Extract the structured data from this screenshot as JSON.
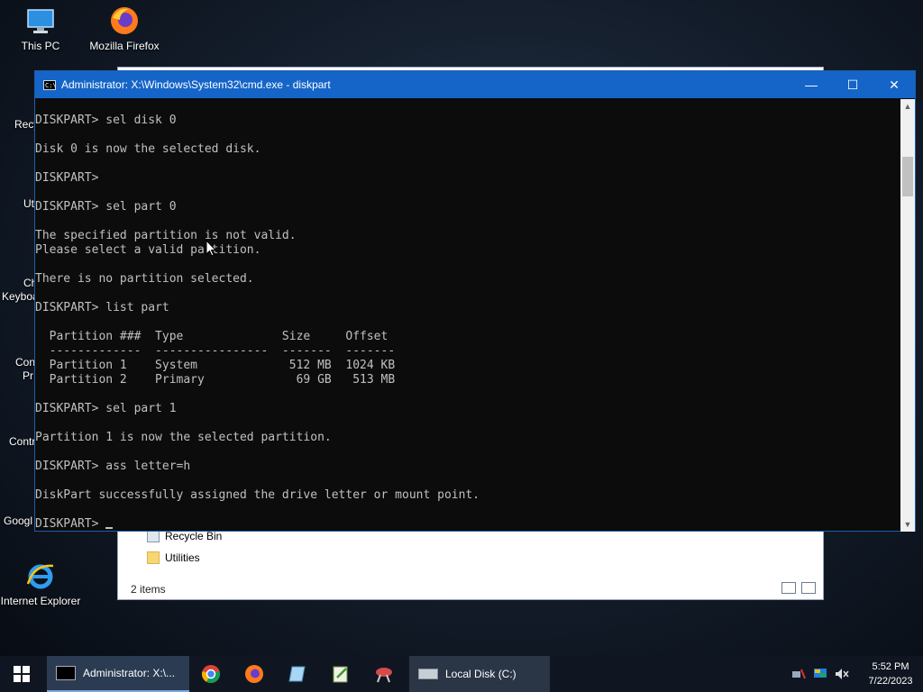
{
  "desktop": {
    "icons": [
      {
        "label": "This PC",
        "icon": "this-pc-icon"
      },
      {
        "label": "Mozilla Firefox",
        "icon": "firefox-icon"
      },
      {
        "label": "Internet Explorer",
        "icon": "internet-explorer-icon"
      }
    ],
    "partial_labels": [
      "Recy",
      "Ut",
      "Ch",
      "Keyboa",
      "Con",
      "Pr",
      "Contr",
      "Googl"
    ]
  },
  "explorer": {
    "items": [
      {
        "label": "Recycle Bin",
        "icon": "recycle-bin-icon"
      },
      {
        "label": "Utilities",
        "icon": "folder-icon"
      }
    ],
    "status": "2 items"
  },
  "cmd": {
    "title": "Administrator: X:\\Windows\\System32\\cmd.exe - diskpart",
    "lines": [
      "DISKPART> sel disk 0",
      "",
      "Disk 0 is now the selected disk.",
      "",
      "DISKPART>",
      "",
      "DISKPART> sel part 0",
      "",
      "The specified partition is not valid.",
      "Please select a valid partition.",
      "",
      "There is no partition selected.",
      "",
      "DISKPART> list part",
      "",
      "  Partition ###  Type              Size     Offset",
      "  -------------  ----------------  -------  -------",
      "  Partition 1    System             512 MB  1024 KB",
      "  Partition 2    Primary             69 GB   513 MB",
      "",
      "DISKPART> sel part 1",
      "",
      "Partition 1 is now the selected partition.",
      "",
      "DISKPART> ass letter=h",
      "",
      "DiskPart successfully assigned the drive letter or mount point.",
      ""
    ],
    "prompt": "DISKPART> "
  },
  "taskbar": {
    "items": [
      {
        "label": "Administrator: X:\\...",
        "icon": "cmd-icon",
        "active": true
      },
      {
        "label": "Local Disk (C:)",
        "icon": "drive-icon",
        "active": false
      }
    ],
    "pinned": [
      "chrome-icon",
      "firefox-icon",
      "notepad-icon",
      "edit-icon",
      "tool-icon"
    ],
    "clock": {
      "time": "5:52 PM",
      "date": "7/22/2023"
    }
  },
  "colors": {
    "titlebar": "#1565c8",
    "console_bg": "#0c0c0c",
    "console_text": "#c0c0c0",
    "taskbar": "#101621"
  }
}
